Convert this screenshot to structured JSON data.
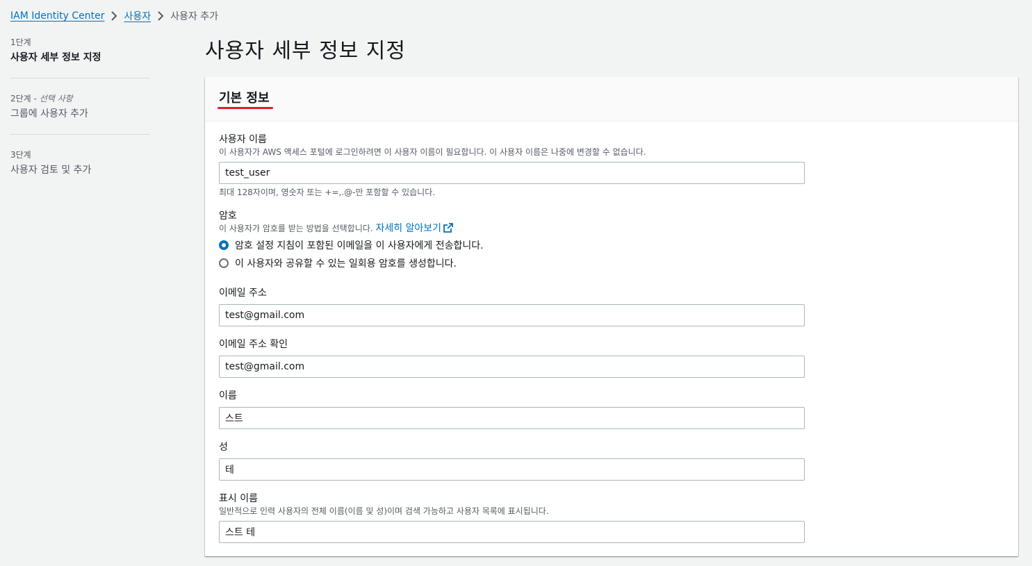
{
  "breadcrumb": {
    "items": [
      {
        "label": "IAM Identity Center"
      },
      {
        "label": "사용자"
      }
    ],
    "current": "사용자 추가"
  },
  "steps": [
    {
      "number": "1단계",
      "optional": "",
      "title": "사용자 세부 정보 지정",
      "active": true
    },
    {
      "number": "2단계 - ",
      "optional": "선택 사항",
      "title": "그룹에 사용자 추가",
      "active": false
    },
    {
      "number": "3단계",
      "optional": "",
      "title": "사용자 검토 및 추가",
      "active": false
    }
  ],
  "page_title": "사용자 세부 정보 지정",
  "section": {
    "title": "기본 정보"
  },
  "form": {
    "username": {
      "label": "사용자 이름",
      "description": "이 사용자가 AWS 액세스 포털에 로그인하려면 이 사용자 이름이 필요합니다. 이 사용자 이름은 나중에 변경할 수 없습니다.",
      "value": "test_user",
      "constraint": "최대 128자이며, 영숫자 또는 +=,.@-만 포함할 수 있습니다."
    },
    "password": {
      "label": "암호",
      "description": "이 사용자가 암호를 받는 방법을 선택합니다.",
      "learn_more": "자세히 알아보기",
      "options": [
        {
          "label": "암호 설정 지침이 포함된 이메일을 이 사용자에게 전송합니다.",
          "checked": true
        },
        {
          "label": "이 사용자와 공유할 수 있는 일회용 암호를 생성합니다.",
          "checked": false
        }
      ]
    },
    "email": {
      "label": "이메일 주소",
      "value": "test@gmail.com"
    },
    "email_confirm": {
      "label": "이메일 주소 확인",
      "value": "test@gmail.com"
    },
    "first_name": {
      "label": "이름",
      "value": "스트"
    },
    "last_name": {
      "label": "성",
      "value": "테"
    },
    "display_name": {
      "label": "표시 이름",
      "description": "일반적으로 인력 사용자의 전체 이름(이름 및 성)이며 검색 가능하고 사용자 목록에 표시됩니다.",
      "value": "스트 테"
    }
  },
  "colors": {
    "link": "#0073bb",
    "accent_underline": "#e01e2b",
    "background": "#f2f3f3"
  }
}
